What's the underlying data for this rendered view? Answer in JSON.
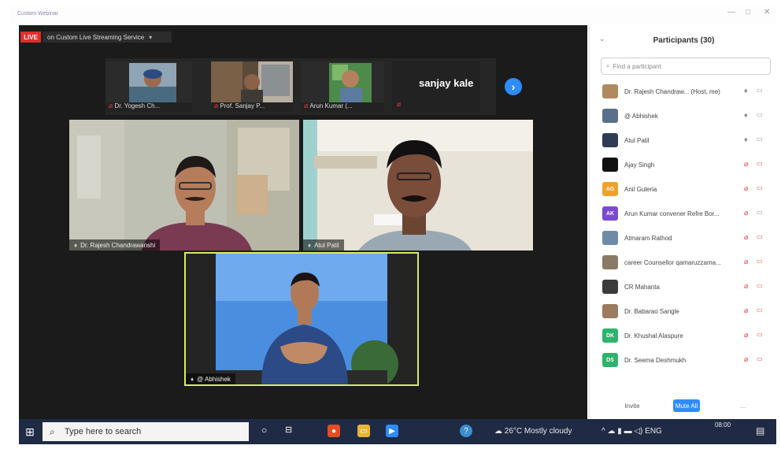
{
  "window": {
    "title": "Custom Webinar"
  },
  "meeting": {
    "live_badge": "LIVE",
    "stream_label": "on Custom Live Streaming Service",
    "stream_chevron": "▾",
    "strip": [
      {
        "name": "Dr. Yogesh Ch..."
      },
      {
        "name": "Prof. Sanjay P..."
      },
      {
        "name": "Arun Kumar (..."
      }
    ],
    "strip_text_tile": "sanjay kale",
    "next_button": "›",
    "tiles": [
      {
        "name": "Dr. Rajesh Chandrawanshi"
      },
      {
        "name": "Atul Patil"
      },
      {
        "name": "@ Abhishek"
      }
    ]
  },
  "participants": {
    "title": "Participants (30)",
    "search_placeholder": "Find a participant",
    "list": [
      {
        "name": "Dr. Rajesh Chandraw...  (Host, me)",
        "initials": "",
        "color": "#b0895f",
        "mic_off": false,
        "video_off": false
      },
      {
        "name": "@ Abhishek",
        "initials": "",
        "color": "#5a6f8c",
        "mic_off": false,
        "video_off": false
      },
      {
        "name": "Atul Patil",
        "initials": "",
        "color": "#2f3d54",
        "mic_off": false,
        "video_off": false
      },
      {
        "name": "Ajay Singh",
        "initials": "",
        "color": "#111111",
        "mic_off": true,
        "video_off": true
      },
      {
        "name": "Anil Guleria",
        "initials": "AG",
        "color": "#f0a12b",
        "mic_off": true,
        "video_off": true
      },
      {
        "name": "Arun Kumar convener Refre Bor...",
        "initials": "AK",
        "color": "#7a4ad0",
        "mic_off": true,
        "video_off": false
      },
      {
        "name": "Atmaram Rathod",
        "initials": "",
        "color": "#6d8aa8",
        "mic_off": true,
        "video_off": true
      },
      {
        "name": "career Counsellor qamaruzzama...",
        "initials": "",
        "color": "#8b7a66",
        "mic_off": true,
        "video_off": true
      },
      {
        "name": "CR Mahanta",
        "initials": "",
        "color": "#3b3b3b",
        "mic_off": true,
        "video_off": true
      },
      {
        "name": "Dr. Babarao Sangle",
        "initials": "",
        "color": "#9c7c5d",
        "mic_off": true,
        "video_off": true
      },
      {
        "name": "Dr. Khushal Alaspure",
        "initials": "DK",
        "color": "#2fb36b",
        "mic_off": true,
        "video_off": true
      },
      {
        "name": "Dr. Seema Deshmukh",
        "initials": "DS",
        "color": "#2fb36b",
        "mic_off": true,
        "video_off": true
      }
    ],
    "invite_label": "Invite",
    "mute_all_label": "Mute All",
    "more_label": "..."
  },
  "taskbar": {
    "search_text": "Type here to search",
    "weather": "26°C  Mostly cloudy",
    "lang": "ENG",
    "time": "08:00"
  },
  "colors": {
    "accent": "#2d8cff",
    "live": "#e02d2d",
    "active_speaker": "#d7ec64",
    "muted": "#e23b3b"
  }
}
